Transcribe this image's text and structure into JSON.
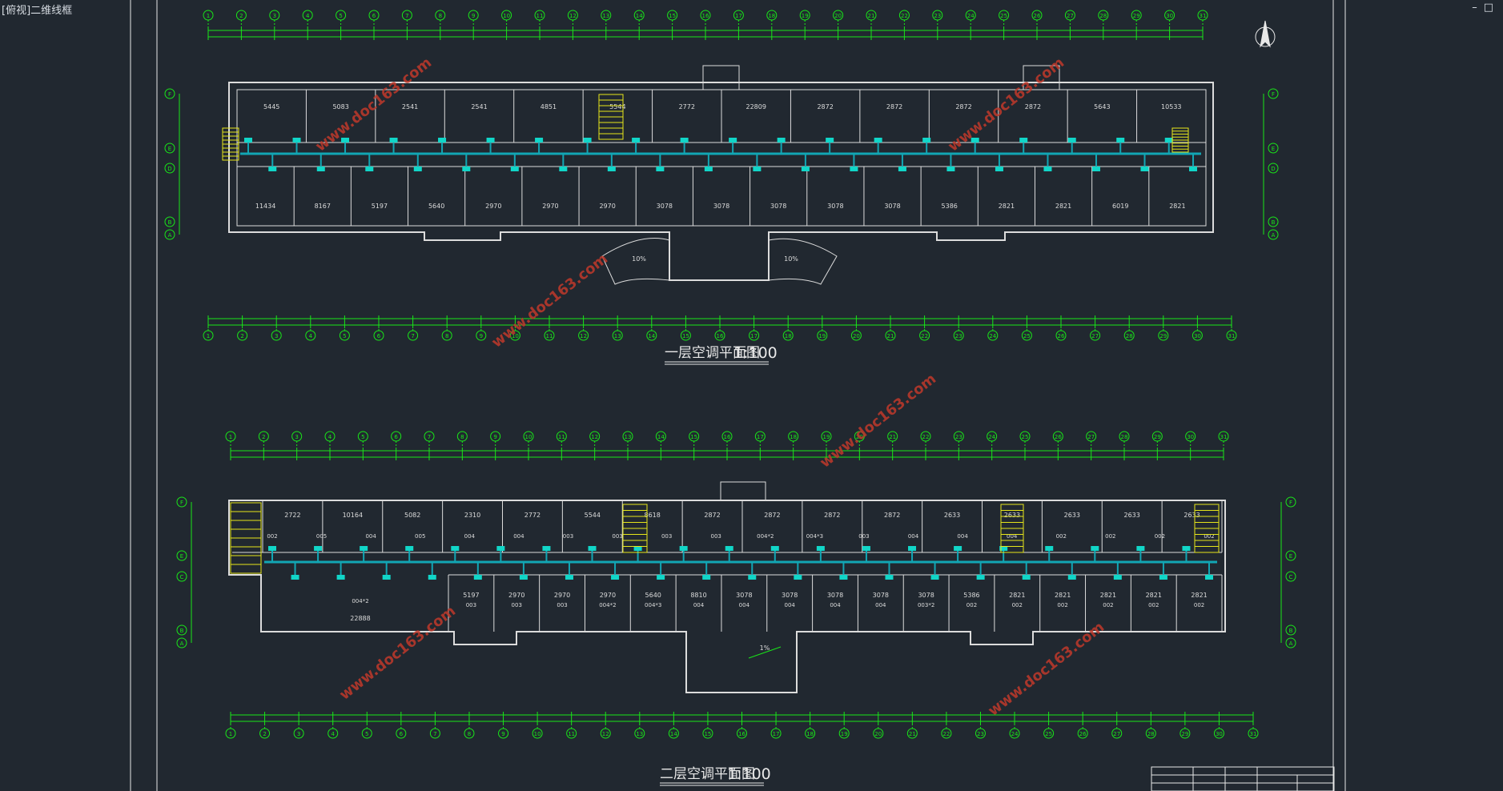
{
  "viewport": {
    "label": "[俯视]二维线框"
  },
  "window_controls": [
    "–",
    "□"
  ],
  "colors": {
    "background": "#212830",
    "frame": "#e8e8e8",
    "axis": "#19e619",
    "wall": "#dcdcdc",
    "duct": "#12a6b4",
    "unit": "#11d6c8",
    "stair": "#e6e61a",
    "watermark": "#c0392b"
  },
  "watermark": "www.doc163.com",
  "plan1": {
    "title": "一层空调平面图",
    "scale": "1:100",
    "axis_numbers": [
      "1",
      "2",
      "3",
      "4",
      "5",
      "6",
      "7",
      "8",
      "9",
      "10",
      "11",
      "12",
      "13",
      "14",
      "15",
      "16",
      "17",
      "18",
      "19",
      "20",
      "21",
      "22",
      "23",
      "24",
      "25",
      "26",
      "27",
      "28",
      "29",
      "30",
      "31"
    ],
    "row_labels": [
      "F",
      "E",
      "D",
      "B",
      "A"
    ],
    "top_areas": [
      "5445",
      "5083",
      "2541",
      "2541",
      "4851",
      "5544",
      "2772",
      "22809",
      "2872",
      "2872",
      "2872",
      "2872",
      "5643",
      "10533"
    ],
    "bottom_areas": [
      "11434",
      "8167",
      "5197",
      "5640",
      "2970",
      "2970",
      "2970",
      "3078",
      "3078",
      "3078",
      "3078",
      "3078",
      "5386",
      "2821",
      "2821",
      "6019",
      "2821"
    ],
    "notes": [
      "10%",
      "10%"
    ]
  },
  "plan2": {
    "title": "二层空调平面图",
    "scale": "1:100",
    "axis_numbers": [
      "1",
      "2",
      "3",
      "4",
      "5",
      "6",
      "7",
      "8",
      "9",
      "10",
      "11",
      "12",
      "13",
      "14",
      "15",
      "16",
      "17",
      "18",
      "19",
      "20",
      "21",
      "22",
      "23",
      "24",
      "25",
      "26",
      "27",
      "28",
      "29",
      "30",
      "31"
    ],
    "row_labels": [
      "F",
      "E",
      "C",
      "B",
      "A"
    ],
    "top_areas": [
      "2722",
      "10164",
      "5082",
      "2310",
      "2772",
      "5544",
      "8618",
      "2872",
      "2872",
      "2872",
      "2872",
      "2633",
      "2633",
      "2633",
      "2633",
      "2633"
    ],
    "top_units": [
      "002",
      "005",
      "004",
      "005",
      "004",
      "004",
      "003",
      "003",
      "003",
      "003",
      "004*2",
      "004*3",
      "003",
      "004",
      "004",
      "004",
      "002",
      "002",
      "002",
      "002"
    ],
    "bottom_areas": [
      "22888",
      "5197",
      "2970",
      "2970",
      "2970",
      "5640",
      "8810",
      "3078",
      "3078",
      "3078",
      "3078",
      "3078",
      "5386",
      "2821",
      "2821",
      "2821",
      "2821",
      "2821"
    ],
    "bottom_units": [
      "004*2",
      "003",
      "003",
      "003",
      "004*2",
      "004*3",
      "004",
      "004",
      "004",
      "004",
      "004",
      "003*2",
      "002",
      "002",
      "002",
      "002",
      "002",
      "002"
    ],
    "notes": [
      "1%"
    ]
  },
  "title_block": {
    "rows": [
      "",
      ""
    ]
  }
}
